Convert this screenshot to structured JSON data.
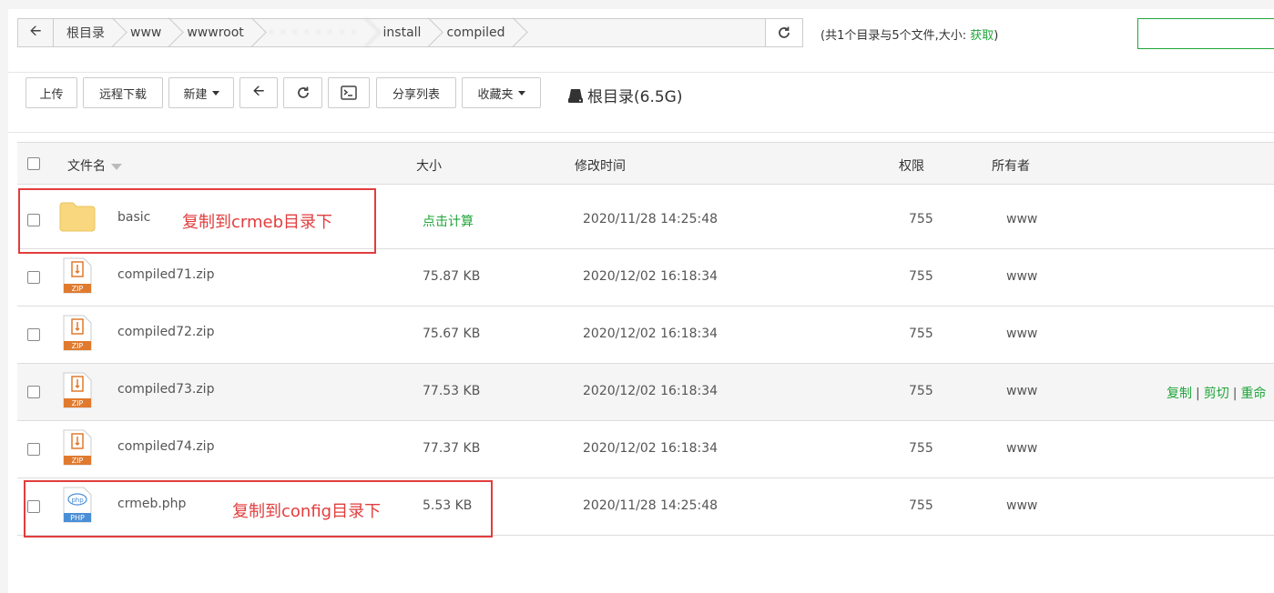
{
  "pathbar": {
    "crumbs": [
      "根目录",
      "www",
      "wwwroot",
      "· · · · · ·  ·  ·",
      "install",
      "compiled"
    ],
    "summary_prefix": "(共1个目录与5个文件,大小: ",
    "summary_link": "获取",
    "summary_suffix": ")"
  },
  "toolbar": {
    "upload": "上传",
    "remote_download": "远程下载",
    "new": "新建",
    "share_list": "分享列表",
    "favorites": "收藏夹",
    "disk_label": "根目录(6.5G)"
  },
  "table": {
    "headers": {
      "name": "文件名",
      "size": "大小",
      "mtime": "修改时间",
      "perm": "权限",
      "owner": "所有者"
    },
    "rows": [
      {
        "name": "basic",
        "size": "点击计算",
        "mtime": "2020/11/28 14:25:48",
        "perm": "755",
        "owner": "www",
        "icon": "folder-icon"
      },
      {
        "name": "compiled71.zip",
        "size": "75.87 KB",
        "mtime": "2020/12/02 16:18:34",
        "perm": "755",
        "owner": "www",
        "icon": "zip-icon"
      },
      {
        "name": "compiled72.zip",
        "size": "75.67 KB",
        "mtime": "2020/12/02 16:18:34",
        "perm": "755",
        "owner": "www",
        "icon": "zip-icon"
      },
      {
        "name": "compiled73.zip",
        "size": "77.53 KB",
        "mtime": "2020/12/02 16:18:34",
        "perm": "755",
        "owner": "www",
        "icon": "zip-icon"
      },
      {
        "name": "compiled74.zip",
        "size": "77.37 KB",
        "mtime": "2020/12/02 16:18:34",
        "perm": "755",
        "owner": "www",
        "icon": "zip-icon"
      },
      {
        "name": "crmeb.php",
        "size": "5.53 KB",
        "mtime": "2020/11/28 14:25:48",
        "perm": "755",
        "owner": "www",
        "icon": "php-icon"
      }
    ],
    "row_ops": {
      "copy": "复制",
      "cut": "剪切",
      "rename": "重命"
    }
  },
  "annotations": {
    "basic_note": "复制到crmeb目录下",
    "php_note": "复制到config目录下"
  },
  "colors": {
    "accent": "#20a53a",
    "annotation": "#e23d3d",
    "zip": "#e07a2e",
    "php": "#4a8fd6",
    "folder": "#f9d77e"
  }
}
